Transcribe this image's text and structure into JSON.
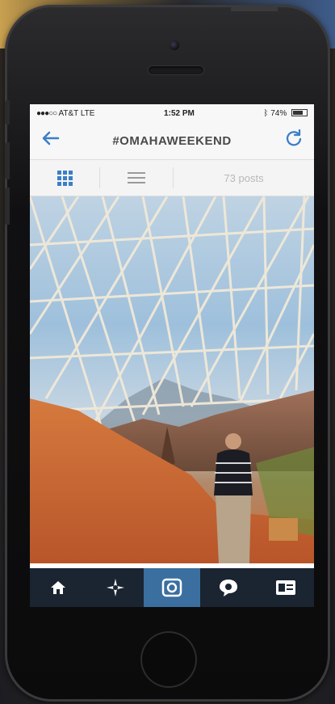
{
  "status": {
    "carrier": "AT&T",
    "network": "LTE",
    "time": "1:52 PM",
    "battery": "74%"
  },
  "nav": {
    "back_icon": "back-arrow-icon",
    "title": "#OMAHAWEEKEND",
    "refresh_icon": "refresh-icon"
  },
  "toolbar": {
    "grid_icon": "grid-view-icon",
    "list_icon": "list-view-icon",
    "posts_count": "73 posts"
  },
  "tabbar": {
    "items": [
      {
        "icon": "home-icon",
        "glyph": "⌂"
      },
      {
        "icon": "explore-icon",
        "glyph": "✦"
      },
      {
        "icon": "camera-icon",
        "glyph": "◙"
      },
      {
        "icon": "activity-icon",
        "glyph": "●"
      },
      {
        "icon": "profile-icon",
        "glyph": "▣"
      }
    ],
    "active_index": 2
  },
  "colors": {
    "accent": "#3b7ec7",
    "tabbar_bg": "#1b2431",
    "tab_active": "#3a6fa0"
  }
}
